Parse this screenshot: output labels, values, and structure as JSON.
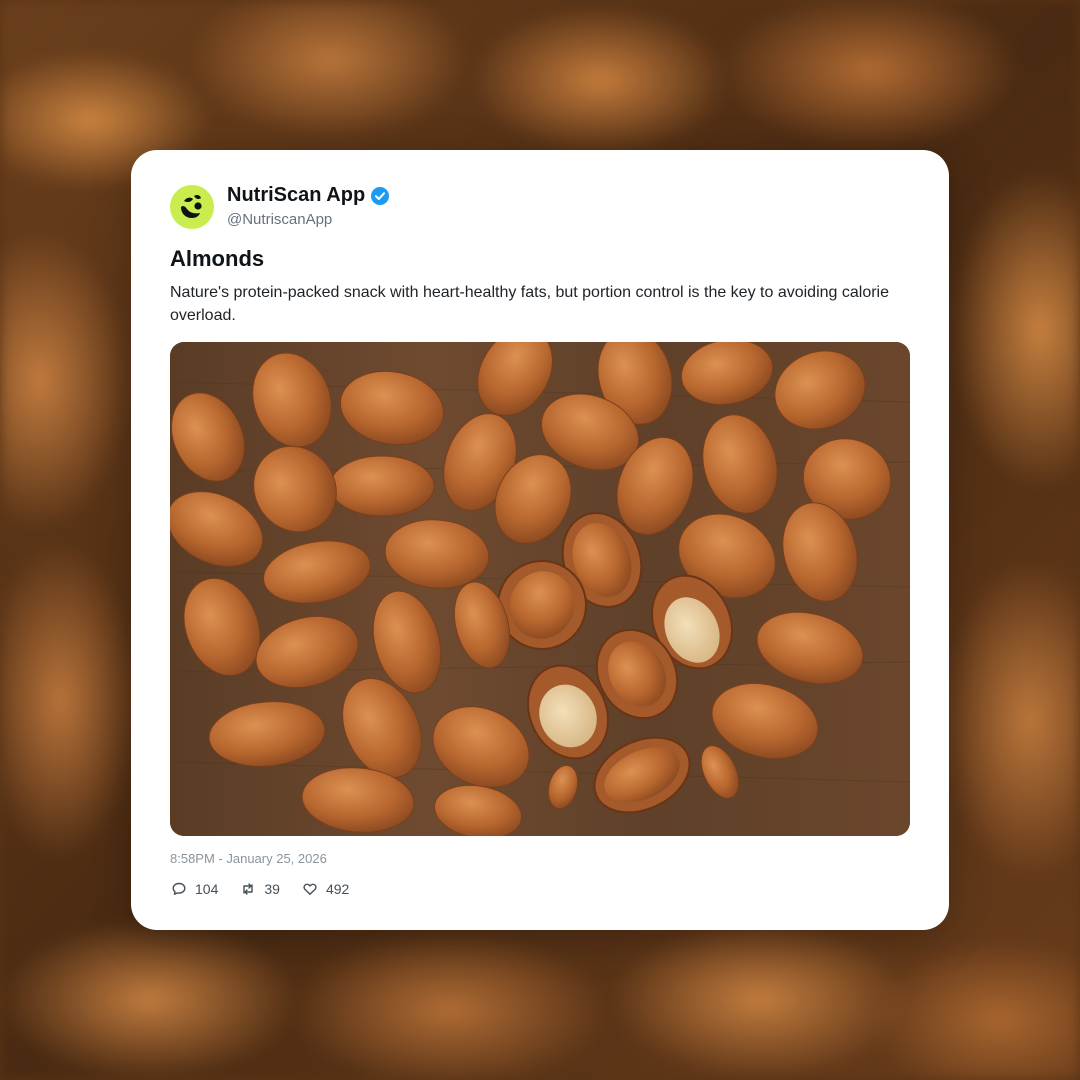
{
  "post": {
    "author_name": "NutriScan App",
    "author_handle": "@NutriscanApp",
    "title": "Almonds",
    "body": "Nature's protein-packed snack with heart-healthy fats, but portion control is the key to avoiding calorie overload.",
    "timestamp": "8:58PM - January 25, 2026",
    "image_alt": "Almonds scattered on a wooden table",
    "stats": {
      "replies": "104",
      "reposts": "39",
      "likes": "492"
    }
  },
  "colors": {
    "avatar_bg": "#c9ec4f",
    "verified_badge": "#1d9bf0",
    "almond": "#b86a35",
    "wood": "#5f412a"
  },
  "icons": {
    "avatar": "nutriscan-logo-icon",
    "verified": "verified-badge-icon",
    "reply": "speech-bubble-icon",
    "repost": "repost-arrows-icon",
    "like": "heart-icon"
  }
}
